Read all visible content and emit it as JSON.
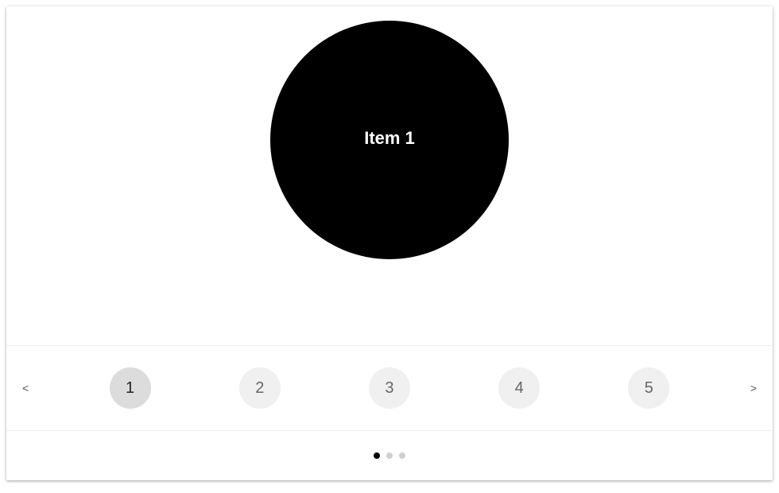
{
  "main": {
    "item_label": "Item 1"
  },
  "nav": {
    "prev": "<",
    "next": ">"
  },
  "thumbs": [
    {
      "label": "1",
      "active": true
    },
    {
      "label": "2",
      "active": false
    },
    {
      "label": "3",
      "active": false
    },
    {
      "label": "4",
      "active": false
    },
    {
      "label": "5",
      "active": false
    }
  ],
  "dots": [
    {
      "active": true
    },
    {
      "active": false
    },
    {
      "active": false
    }
  ]
}
